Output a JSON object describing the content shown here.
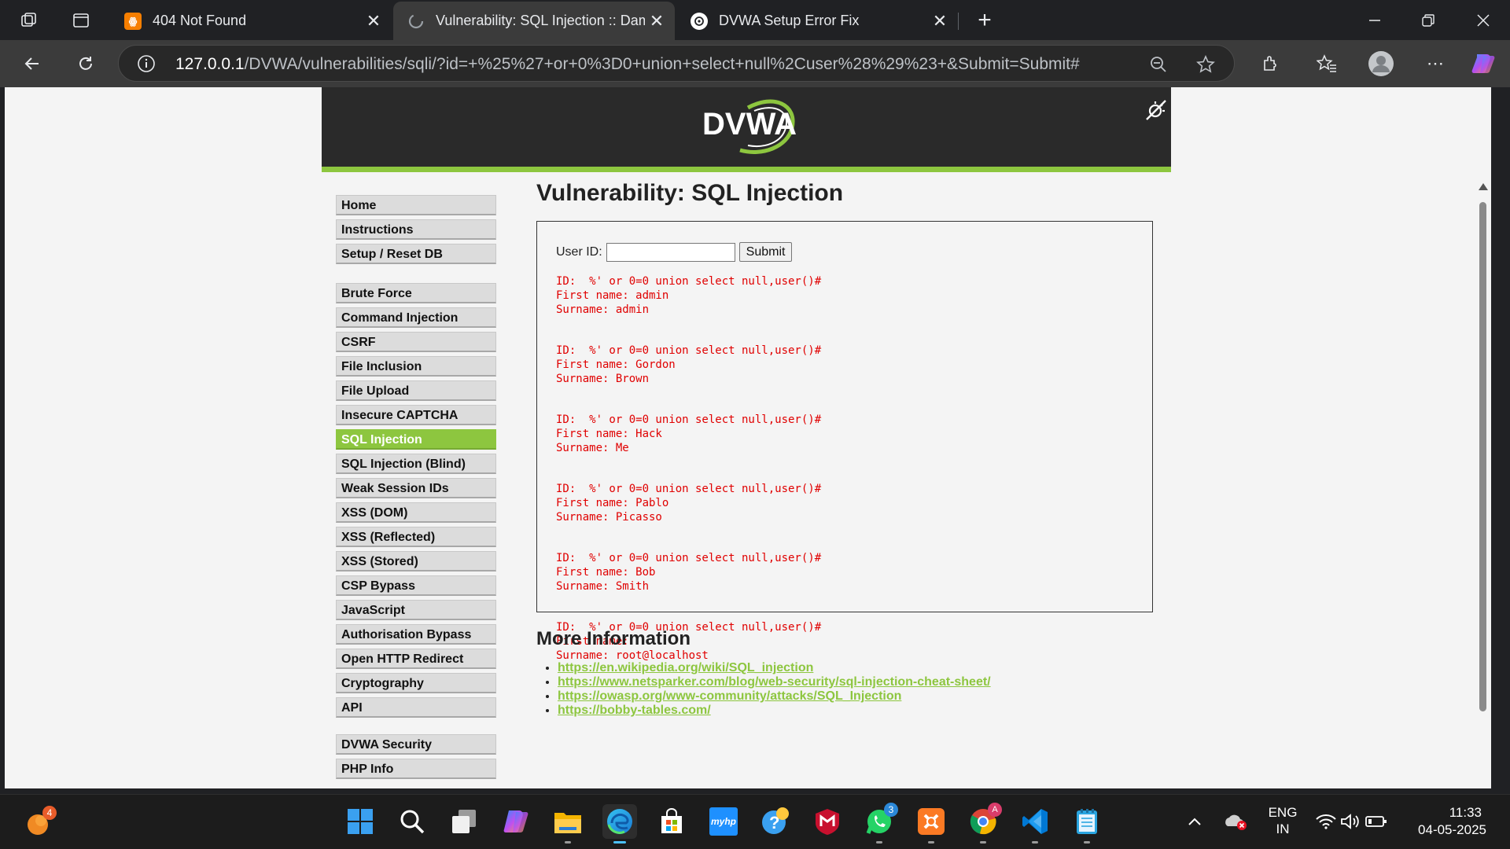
{
  "browser": {
    "tabs": [
      {
        "title": "404 Not Found",
        "favicon": "xampp-icon",
        "active": false
      },
      {
        "title": "Vulnerability: SQL Injection :: Dam",
        "favicon": "loading-icon",
        "active": true
      },
      {
        "title": "DVWA Setup Error Fix",
        "favicon": "openai-icon",
        "active": false
      }
    ],
    "url": {
      "host": "127.0.0.1",
      "path": "/DVWA/vulnerabilities/sqli/?id=+%25%27+or+0%3D0+union+select+null%2Cuser%28%29%23+&Submit=Submit#"
    }
  },
  "dvwa": {
    "logo_text": "DVWA",
    "menu_groups": [
      [
        {
          "label": "Home"
        },
        {
          "label": "Instructions"
        },
        {
          "label": "Setup / Reset DB"
        }
      ],
      [
        {
          "label": "Brute Force"
        },
        {
          "label": "Command Injection"
        },
        {
          "label": "CSRF"
        },
        {
          "label": "File Inclusion"
        },
        {
          "label": "File Upload"
        },
        {
          "label": "Insecure CAPTCHA"
        },
        {
          "label": "SQL Injection",
          "selected": true
        },
        {
          "label": "SQL Injection (Blind)"
        },
        {
          "label": "Weak Session IDs"
        },
        {
          "label": "XSS (DOM)"
        },
        {
          "label": "XSS (Reflected)"
        },
        {
          "label": "XSS (Stored)"
        },
        {
          "label": "CSP Bypass"
        },
        {
          "label": "JavaScript"
        },
        {
          "label": "Authorisation Bypass"
        },
        {
          "label": "Open HTTP Redirect"
        },
        {
          "label": "Cryptography"
        },
        {
          "label": "API"
        }
      ],
      [
        {
          "label": "DVWA Security"
        },
        {
          "label": "PHP Info"
        }
      ]
    ],
    "page_title": "Vulnerability: SQL Injection",
    "form": {
      "label": "User ID:",
      "value": "",
      "submit_label": "Submit"
    },
    "results": [
      {
        "id": "ID:  %' or 0=0 union select null,user()#",
        "first": "First name: admin",
        "surname": "Surname: admin"
      },
      {
        "id": "ID:  %' or 0=0 union select null,user()#",
        "first": "First name: Gordon",
        "surname": "Surname: Brown"
      },
      {
        "id": "ID:  %' or 0=0 union select null,user()#",
        "first": "First name: Hack",
        "surname": "Surname: Me"
      },
      {
        "id": "ID:  %' or 0=0 union select null,user()#",
        "first": "First name: Pablo",
        "surname": "Surname: Picasso"
      },
      {
        "id": "ID:  %' or 0=0 union select null,user()#",
        "first": "First name: Bob",
        "surname": "Surname: Smith"
      },
      {
        "id": "ID:  %' or 0=0 union select null,user()#",
        "first": "First name: ",
        "surname": "Surname: root@localhost"
      }
    ],
    "more_info_title": "More Information",
    "links": [
      "https://en.wikipedia.org/wiki/SQL_injection",
      "https://www.netsparker.com/blog/web-security/sql-injection-cheat-sheet/",
      "https://owasp.org/www-community/attacks/SQL_Injection",
      "https://bobby-tables.com/"
    ],
    "accent_color": "#8dc63f",
    "result_color": "#e00000"
  },
  "taskbar": {
    "weather_badge": "4",
    "apps": [
      {
        "name": "windows-start-icon"
      },
      {
        "name": "search-icon"
      },
      {
        "name": "task-view-icon"
      },
      {
        "name": "copilot-icon"
      },
      {
        "name": "file-explorer-icon"
      },
      {
        "name": "edge-icon"
      },
      {
        "name": "microsoft-store-icon"
      },
      {
        "name": "myhp-icon",
        "label": "myhp"
      },
      {
        "name": "get-help-icon"
      },
      {
        "name": "mcafee-icon"
      },
      {
        "name": "whatsapp-icon",
        "badge": "3"
      },
      {
        "name": "xampp-icon"
      },
      {
        "name": "chrome-icon",
        "badge": "A"
      },
      {
        "name": "vscode-icon"
      },
      {
        "name": "notepad-icon"
      }
    ],
    "language": "ENG",
    "region": "IN",
    "time": "11:33",
    "date": "04-05-2025"
  }
}
